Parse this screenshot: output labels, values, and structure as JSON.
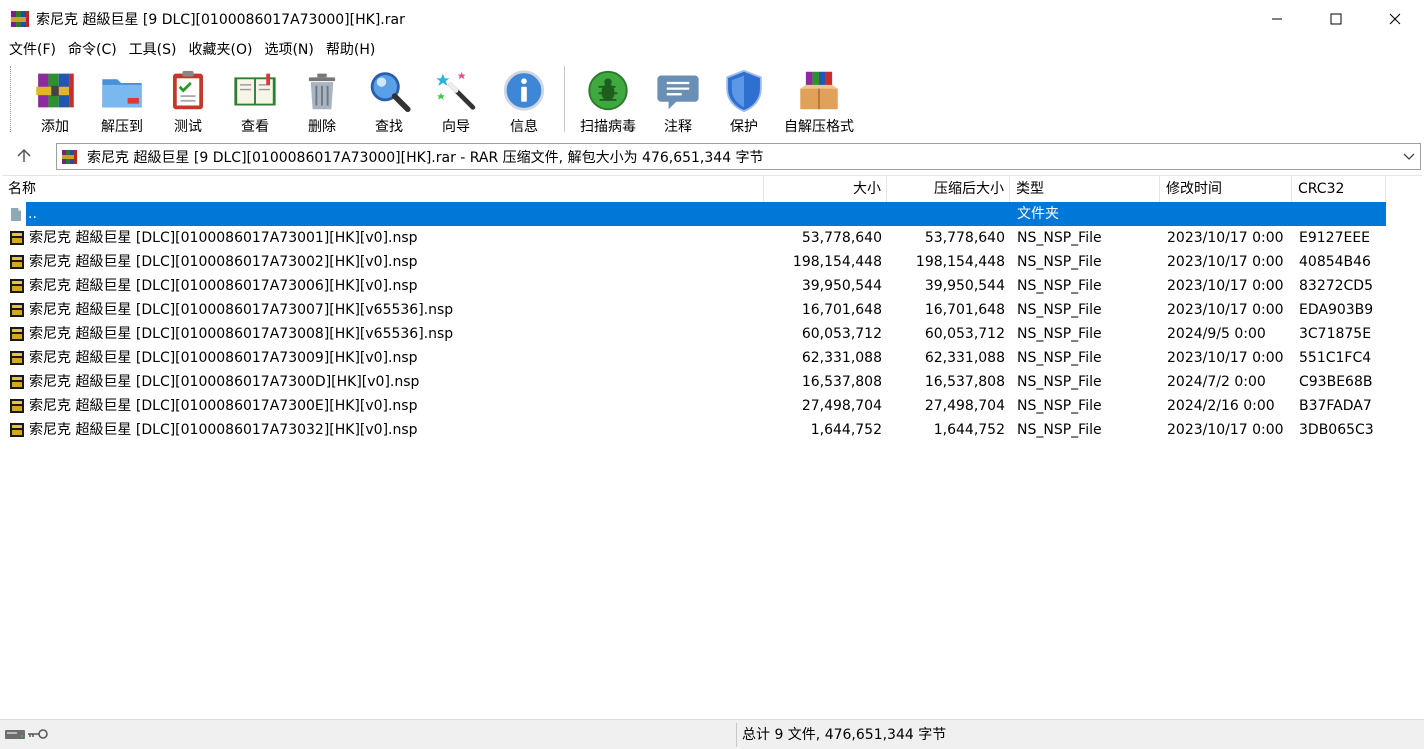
{
  "window": {
    "title": "索尼克 超級巨星 [9 DLC][0100086017A73000][HK].rar",
    "app_icon": "winrar-books-icon"
  },
  "menu": [
    {
      "label": "文件(F)"
    },
    {
      "label": "命令(C)"
    },
    {
      "label": "工具(S)"
    },
    {
      "label": "收藏夹(O)"
    },
    {
      "label": "选项(N)"
    },
    {
      "label": "帮助(H)"
    }
  ],
  "toolbar": [
    {
      "label": "添加",
      "icon": "add-archive-icon"
    },
    {
      "label": "解压到",
      "icon": "extract-folder-icon"
    },
    {
      "label": "测试",
      "icon": "test-clipboard-icon"
    },
    {
      "label": "查看",
      "icon": "view-book-icon"
    },
    {
      "label": "删除",
      "icon": "trash-icon"
    },
    {
      "label": "查找",
      "icon": "magnifier-icon"
    },
    {
      "label": "向导",
      "icon": "wizard-wand-icon"
    },
    {
      "label": "信息",
      "icon": "info-icon"
    },
    {
      "label": "扫描病毒",
      "icon": "virus-scan-icon"
    },
    {
      "label": "注释",
      "icon": "comment-icon"
    },
    {
      "label": "保护",
      "icon": "shield-icon"
    },
    {
      "label": "自解压格式",
      "icon": "sfx-box-icon"
    }
  ],
  "address": {
    "text": "索尼克 超級巨星 [9 DLC][0100086017A73000][HK].rar - RAR 压缩文件, 解包大小为 476,651,344 字节"
  },
  "columns": [
    "名称",
    "大小",
    "压缩后大小",
    "类型",
    "修改时间",
    "CRC32"
  ],
  "rows": [
    {
      "name": "..",
      "size": "",
      "packed": "",
      "type": "文件夹",
      "modified": "",
      "crc": "",
      "selected": true,
      "icon": "folder-up-icon"
    },
    {
      "name": "索尼克 超級巨星 [DLC][0100086017A73001][HK][v0].nsp",
      "size": "53,778,640",
      "packed": "53,778,640",
      "type": "NS_NSP_File",
      "modified": "2023/10/17 0:00",
      "crc": "E9127EEE",
      "icon": "nsp-file-icon"
    },
    {
      "name": "索尼克 超級巨星 [DLC][0100086017A73002][HK][v0].nsp",
      "size": "198,154,448",
      "packed": "198,154,448",
      "type": "NS_NSP_File",
      "modified": "2023/10/17 0:00",
      "crc": "40854B46",
      "icon": "nsp-file-icon"
    },
    {
      "name": "索尼克 超級巨星 [DLC][0100086017A73006][HK][v0].nsp",
      "size": "39,950,544",
      "packed": "39,950,544",
      "type": "NS_NSP_File",
      "modified": "2023/10/17 0:00",
      "crc": "83272CD5",
      "icon": "nsp-file-icon"
    },
    {
      "name": "索尼克 超級巨星 [DLC][0100086017A73007][HK][v65536].nsp",
      "size": "16,701,648",
      "packed": "16,701,648",
      "type": "NS_NSP_File",
      "modified": "2023/10/17 0:00",
      "crc": "EDA903B9",
      "icon": "nsp-file-icon"
    },
    {
      "name": "索尼克 超級巨星 [DLC][0100086017A73008][HK][v65536].nsp",
      "size": "60,053,712",
      "packed": "60,053,712",
      "type": "NS_NSP_File",
      "modified": "2024/9/5 0:00",
      "crc": "3C71875E",
      "icon": "nsp-file-icon"
    },
    {
      "name": "索尼克 超級巨星 [DLC][0100086017A73009][HK][v0].nsp",
      "size": "62,331,088",
      "packed": "62,331,088",
      "type": "NS_NSP_File",
      "modified": "2023/10/17 0:00",
      "crc": "551C1FC4",
      "icon": "nsp-file-icon"
    },
    {
      "name": "索尼克 超級巨星 [DLC][0100086017A7300D][HK][v0].nsp",
      "size": "16,537,808",
      "packed": "16,537,808",
      "type": "NS_NSP_File",
      "modified": "2024/7/2 0:00",
      "crc": "C93BE68B",
      "icon": "nsp-file-icon"
    },
    {
      "name": "索尼克 超級巨星 [DLC][0100086017A7300E][HK][v0].nsp",
      "size": "27,498,704",
      "packed": "27,498,704",
      "type": "NS_NSP_File",
      "modified": "2024/2/16 0:00",
      "crc": "B37FADA7",
      "icon": "nsp-file-icon"
    },
    {
      "name": "索尼克 超級巨星 [DLC][0100086017A73032][HK][v0].nsp",
      "size": "1,644,752",
      "packed": "1,644,752",
      "type": "NS_NSP_File",
      "modified": "2023/10/17 0:00",
      "crc": "3DB065C3",
      "icon": "nsp-file-icon"
    }
  ],
  "status": {
    "text": "总计 9 文件, 476,651,344 字节",
    "icons": [
      "drive-icon",
      "key-icon"
    ]
  },
  "colors": {
    "selection": "#0078d7",
    "header_divider": "#e5e5e5",
    "statusbar_bg": "#f0f0f0"
  }
}
